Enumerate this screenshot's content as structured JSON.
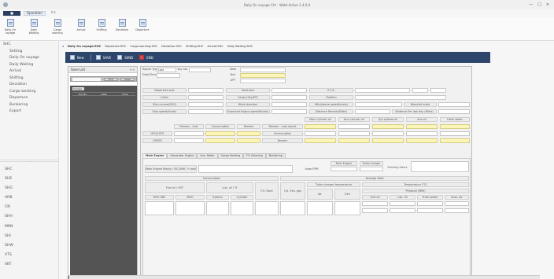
{
  "window": {
    "title": "Daily On voyage Ctrl - Wabt Active 1.4.0.0",
    "controls": [
      "—",
      "□",
      "×"
    ]
  },
  "ribbon_tabs": [
    "Operation",
    "Ins"
  ],
  "file_label": "■",
  "ribbon_buttons": [
    "Daily On voyage",
    "Daily Waiting",
    "Cargo working",
    "Arrival",
    "Shifting",
    "Deviation",
    "Departure"
  ],
  "sidebar": {
    "top_head": "SHC",
    "top_items": [
      "Setting",
      "Daily On voyage",
      "Daily Waiting",
      "Arrival",
      "Shifting",
      "Deviation",
      "Cargo working",
      "Departure",
      "Bunkering",
      "Export"
    ],
    "lower_items": [
      "SHC",
      "SHE",
      "SHG",
      "ARB",
      "CN",
      "SHH",
      "MRN",
      "SHI",
      "SHW",
      "VTS",
      "SKT"
    ]
  },
  "doc_tabs": [
    "Daily On voyage:SHC",
    "Departure:SHC",
    "Cargo working:SHC",
    "Deviation:SHC",
    "Shifting:SHC",
    "Arrival:SHC",
    "Daily Waiting:SHC"
  ],
  "toolbar": {
    "new": "New",
    "save": "SAVE",
    "send": "SEND",
    "end": "END"
  },
  "save_list": {
    "title": "Save List",
    "close": "▾ x",
    "btn1": "Find",
    "btn2": "Clear",
    "group": "Voyage",
    "cols": [
      "Voy No.",
      "Date",
      "Time"
    ]
  },
  "form": {
    "report_type_label": "Report Type",
    "report_type_value": "Last",
    "voy_no_label": "Voy. No.",
    "date_label": "Date/Time",
    "top_right_labels": [
      "Date",
      "Nmi",
      "APT"
    ],
    "row_labels": [
      [
        "Departure port",
        "Next port",
        "E.T.A."
      ],
      [
        "Cabin",
        "Cargo (Qty/MT)",
        "Position"
      ],
      [
        "Ship course(DEG)",
        "Wind direction",
        "Wind/wave speed(knots)",
        "Beaufort scale"
      ],
      [
        "Ship speed(Knots)",
        "Expected Engine speed(Knots)",
        "Distance Remain(Miles)",
        "Distance Per last day (Miles)"
      ]
    ],
    "fuel_cols": [
      "Main cylinder oil",
      "Aux cylinder oil",
      "Sys system oil",
      "Aux oil",
      "Fresh water"
    ],
    "fuel_row_labels": [
      "Remain - Last",
      "Consumption",
      "Remain",
      "Remain - Last report"
    ],
    "fuel_rows": [
      "HFO/LSFO",
      "LSMGO"
    ],
    "fuel_right": [
      "Consumption",
      "Remain"
    ],
    "sub_tabs": [
      "Main Engine",
      "Generator Engine",
      "Aux. Boiler",
      "Cargo Heating",
      "FO Cleaning",
      "Bunkering"
    ],
    "me": {
      "load_label": "Main Engine Mainly / 85-20MC + load",
      "rpm_label": "Ange RPM",
      "me_label": "Main Engine",
      "tc_label": "Turbo charger",
      "rh_label": "Running Hours"
    },
    "headers": {
      "consumption": "Consumption",
      "average": "Average Data",
      "tc_temp": "Turbo charger temperature",
      "temperature": "Temperature (°C)",
      "pressure": "Pressure (MPa)"
    },
    "subheaders": [
      "Fuel oil / HVT",
      "Lub. oil / Tt",
      "F.O. Rack",
      "Cyl. Exh. gas Temp",
      "Air",
      "Exh",
      "Fuel oil",
      "Lub. Oil",
      "Fresh water",
      "Scav. Air",
      "MFO-3BC",
      "MDO",
      "System",
      "Cylinder"
    ]
  }
}
